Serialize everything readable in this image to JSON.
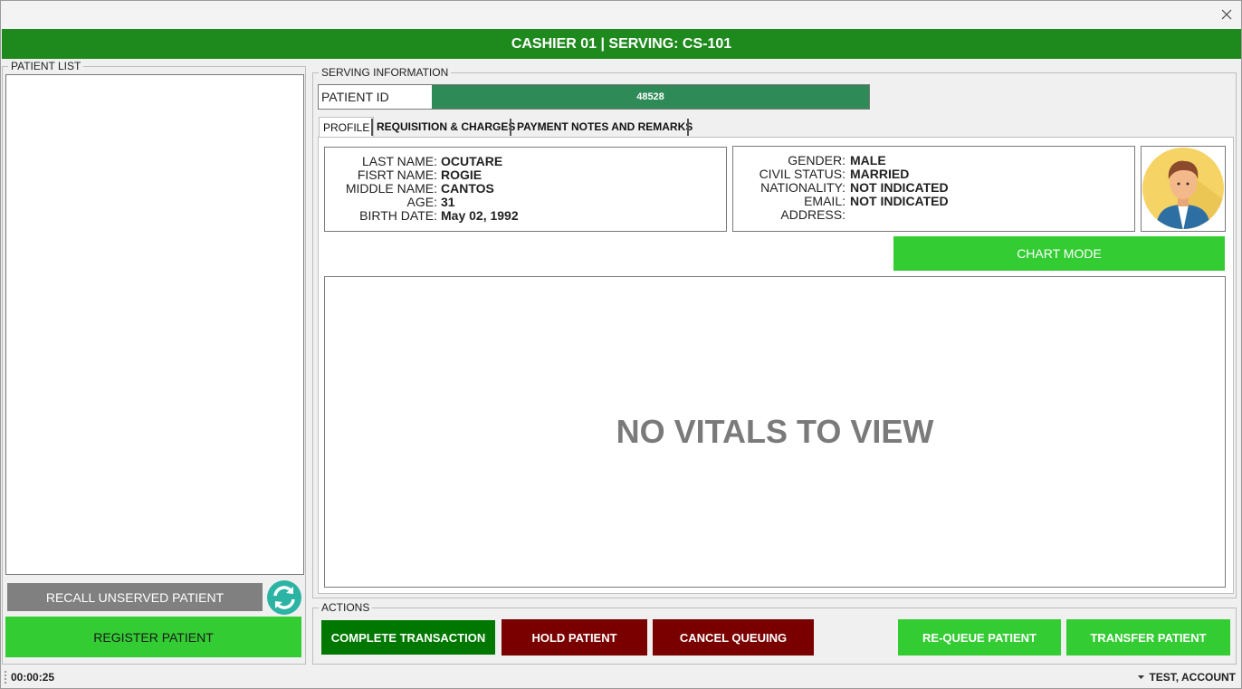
{
  "header": {
    "title": "CASHIER 01 | SERVING: CS-101"
  },
  "patient_list": {
    "legend": "PATIENT LIST"
  },
  "buttons": {
    "recall": "RECALL UNSERVED PATIENT",
    "register": "REGISTER PATIENT",
    "chart_mode": "CHART MODE"
  },
  "serving": {
    "legend": "SERVING INFORMATION",
    "patient_id_label": "PATIENT ID",
    "patient_id_value": "48528"
  },
  "tabs": [
    {
      "label": "PROFILE",
      "active": true
    },
    {
      "label": "REQUISITION & CHARGES",
      "active": false
    },
    {
      "label": "PAYMENT NOTES AND REMARKS",
      "active": false
    }
  ],
  "profile": {
    "left": [
      {
        "label": "LAST NAME:",
        "value": "OCUTARE"
      },
      {
        "label": "FISRT NAME:",
        "value": "ROGIE"
      },
      {
        "label": "MIDDLE NAME:",
        "value": "CANTOS"
      },
      {
        "label": "AGE:",
        "value": "31"
      },
      {
        "label": "BIRTH DATE:",
        "value": "May 02, 1992"
      }
    ],
    "right": [
      {
        "label": "GENDER:",
        "value": "MALE"
      },
      {
        "label": "CIVIL STATUS:",
        "value": "MARRIED"
      },
      {
        "label": "NATIONALITY:",
        "value": "NOT INDICATED"
      },
      {
        "label": "EMAIL:",
        "value": "NOT INDICATED"
      },
      {
        "label": "ADDRESS:",
        "value": ""
      }
    ]
  },
  "vitals": {
    "empty_text": "NO VITALS TO VIEW"
  },
  "actions": {
    "legend": "ACTIONS",
    "complete": "COMPLETE TRANSACTION",
    "hold": "HOLD PATIENT",
    "cancel": "CANCEL QUEUING",
    "requeue": "RE-QUEUE PATIENT",
    "transfer": "TRANSFER PATIENT"
  },
  "status": {
    "timer": "00:00:25",
    "account": "TEST, ACCOUNT"
  },
  "colors": {
    "header_green": "#1e8a1e",
    "patient_id_green": "#2e8b57",
    "bright_green": "#33cc33",
    "dark_green": "#007800",
    "dark_red": "#7a0000",
    "gray": "#808080"
  },
  "icons": {
    "close": "close-icon",
    "refresh": "refresh-icon",
    "avatar": "user-avatar-icon",
    "dropdown": "caret-down-icon"
  }
}
